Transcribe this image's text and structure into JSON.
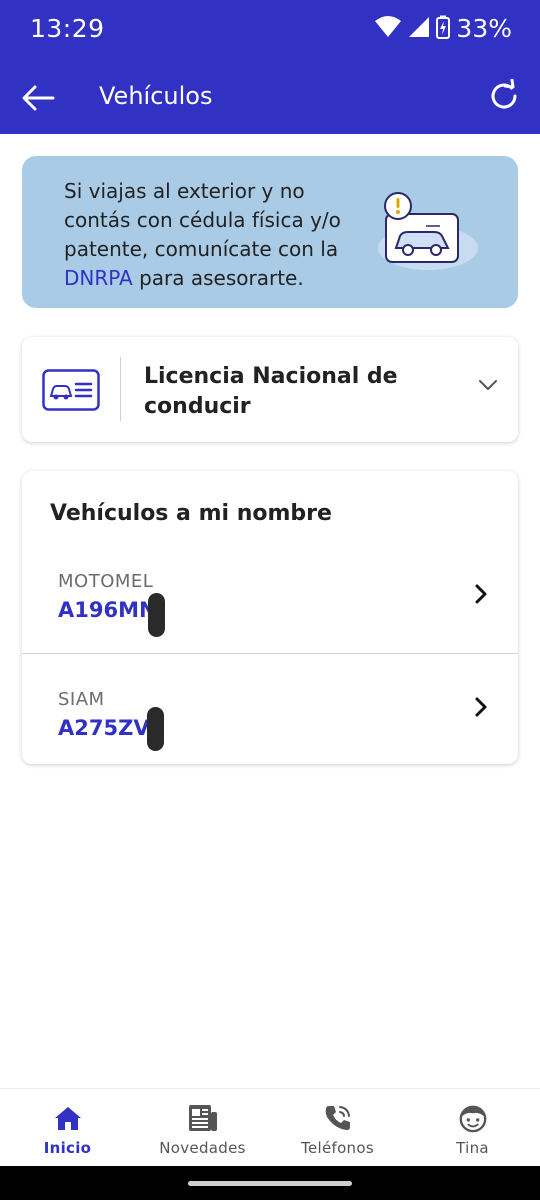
{
  "status_bar": {
    "time": "13:29",
    "battery": "33%"
  },
  "app_bar": {
    "title": "Vehículos"
  },
  "banner": {
    "text_before_link": "Si viajas al exterior y no contás con cédula física y/o patente, comunícate con la ",
    "link": "DNRPA",
    "text_after_link": " para asesorarte."
  },
  "license": {
    "title": "Licencia Nacional de conducir"
  },
  "vehicles": {
    "title": "Vehículos a mi nombre",
    "items": [
      {
        "brand": "MOTOMEL",
        "plate": "A196MN"
      },
      {
        "brand": "SIAM",
        "plate": "A275ZV"
      }
    ]
  },
  "bottom_nav": {
    "items": [
      {
        "label": "Inicio",
        "icon": "home-icon",
        "active": true
      },
      {
        "label": "Novedades",
        "icon": "newspaper-icon",
        "active": false
      },
      {
        "label": "Teléfonos",
        "icon": "phone-icon",
        "active": false
      },
      {
        "label": "Tina",
        "icon": "tina-avatar-icon",
        "active": false
      }
    ]
  },
  "colors": {
    "primary": "#3131c4",
    "banner_bg": "#a9cbe6"
  }
}
